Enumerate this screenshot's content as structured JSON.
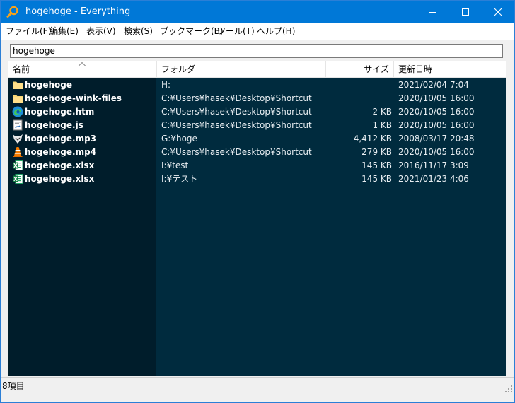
{
  "window": {
    "title": "hogehoge - Everything",
    "app_icon": "magnifier-icon",
    "accent_color": "#0078d7"
  },
  "menu": [
    {
      "label": "ファイル(F)"
    },
    {
      "label": "編集(E)"
    },
    {
      "label": "表示(V)"
    },
    {
      "label": "検索(S)"
    },
    {
      "label": "ブックマーク(B)"
    },
    {
      "label": "ツール(T)"
    },
    {
      "label": "ヘルプ(H)"
    }
  ],
  "search": {
    "value": "hogehoge"
  },
  "columns": {
    "name": "名前",
    "folder": "フォルダ",
    "size": "サイズ",
    "date": "更新日時",
    "sort_indicator": "sort-ascending-icon"
  },
  "rows": [
    {
      "icon": "folder-icon",
      "name": "hogehoge",
      "folder": "H:",
      "size": "",
      "date": "2021/02/04 7:04"
    },
    {
      "icon": "folder-icon",
      "name": "hogehoge-wink-files",
      "folder": "C:¥Users¥hasek¥Desktop¥Shortcut",
      "size": "",
      "date": "2020/10/05 16:00"
    },
    {
      "icon": "edge-icon",
      "name": "hogehoge.htm",
      "folder": "C:¥Users¥hasek¥Desktop¥Shortcut",
      "size": "2 KB",
      "date": "2020/10/05 16:00"
    },
    {
      "icon": "script-icon",
      "name": "hogehoge.js",
      "folder": "C:¥Users¥hasek¥Desktop¥Shortcut",
      "size": "1 KB",
      "date": "2020/10/05 16:00"
    },
    {
      "icon": "audio-player-icon",
      "name": "hogehoge.mp3",
      "folder": "G:¥hoge",
      "size": "4,412 KB",
      "date": "2008/03/17 20:48"
    },
    {
      "icon": "vlc-cone-icon",
      "name": "hogehoge.mp4",
      "folder": "C:¥Users¥hasek¥Desktop¥Shortcut",
      "size": "279 KB",
      "date": "2020/10/05 16:00"
    },
    {
      "icon": "excel-icon",
      "name": "hogehoge.xlsx",
      "folder": "I:¥test",
      "size": "145 KB",
      "date": "2016/11/17 3:09"
    },
    {
      "icon": "excel-icon",
      "name": "hogehoge.xlsx",
      "folder": "I:¥テスト",
      "size": "145 KB",
      "date": "2021/01/23 4:06"
    }
  ],
  "status": {
    "text": "8項目"
  },
  "colors": {
    "list_background": "#002b3e",
    "name_column_background": "#001d2b"
  }
}
